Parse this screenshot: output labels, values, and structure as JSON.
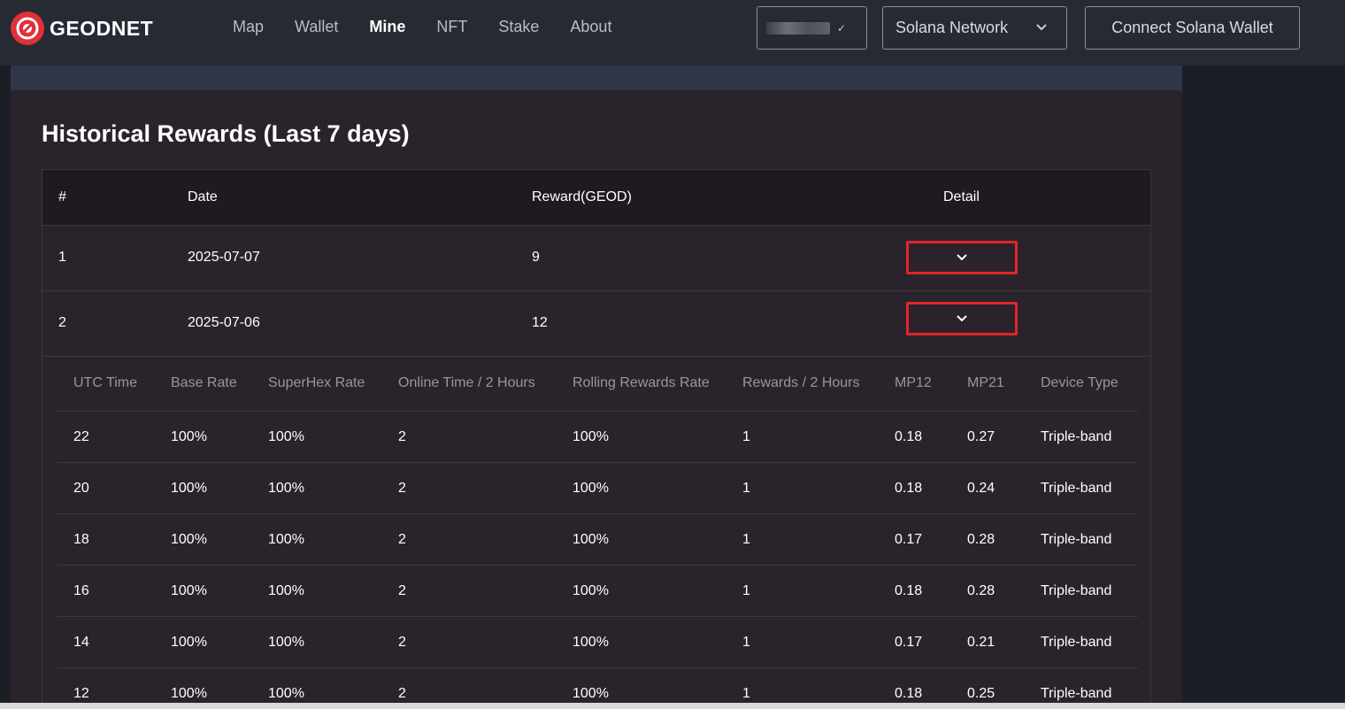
{
  "brand": {
    "name": "GEODNET"
  },
  "nav": [
    {
      "label": "Map",
      "active": false
    },
    {
      "label": "Wallet",
      "active": false
    },
    {
      "label": "Mine",
      "active": true
    },
    {
      "label": "NFT",
      "active": false
    },
    {
      "label": "Stake",
      "active": false
    },
    {
      "label": "About",
      "active": false
    }
  ],
  "header": {
    "network_label": "Solana Network",
    "connect_label": "Connect Solana Wallet"
  },
  "section": {
    "title": "Historical Rewards (Last 7 days)"
  },
  "rewards_table": {
    "columns": [
      "#",
      "Date",
      "Reward(GEOD)",
      "Detail"
    ],
    "rows": [
      {
        "index": "1",
        "date": "2025-07-07",
        "reward": "9"
      },
      {
        "index": "2",
        "date": "2025-07-06",
        "reward": "12"
      }
    ]
  },
  "detail_table": {
    "columns": [
      "UTC Time",
      "Base Rate",
      "SuperHex Rate",
      "Online Time / 2 Hours",
      "Rolling Rewards Rate",
      "Rewards / 2 Hours",
      "MP12",
      "MP21",
      "Device Type"
    ],
    "rows": [
      [
        "22",
        "100%",
        "100%",
        "2",
        "100%",
        "1",
        "0.18",
        "0.27",
        "Triple-band"
      ],
      [
        "20",
        "100%",
        "100%",
        "2",
        "100%",
        "1",
        "0.18",
        "0.24",
        "Triple-band"
      ],
      [
        "18",
        "100%",
        "100%",
        "2",
        "100%",
        "1",
        "0.17",
        "0.28",
        "Triple-band"
      ],
      [
        "16",
        "100%",
        "100%",
        "2",
        "100%",
        "1",
        "0.18",
        "0.28",
        "Triple-band"
      ],
      [
        "14",
        "100%",
        "100%",
        "2",
        "100%",
        "1",
        "0.17",
        "0.21",
        "Triple-band"
      ],
      [
        "12",
        "100%",
        "100%",
        "2",
        "100%",
        "1",
        "0.18",
        "0.25",
        "Triple-band"
      ]
    ]
  },
  "colors": {
    "accent_red": "#e0262b",
    "header_bg": "#262a33",
    "panel_bg": "#2a232b"
  }
}
